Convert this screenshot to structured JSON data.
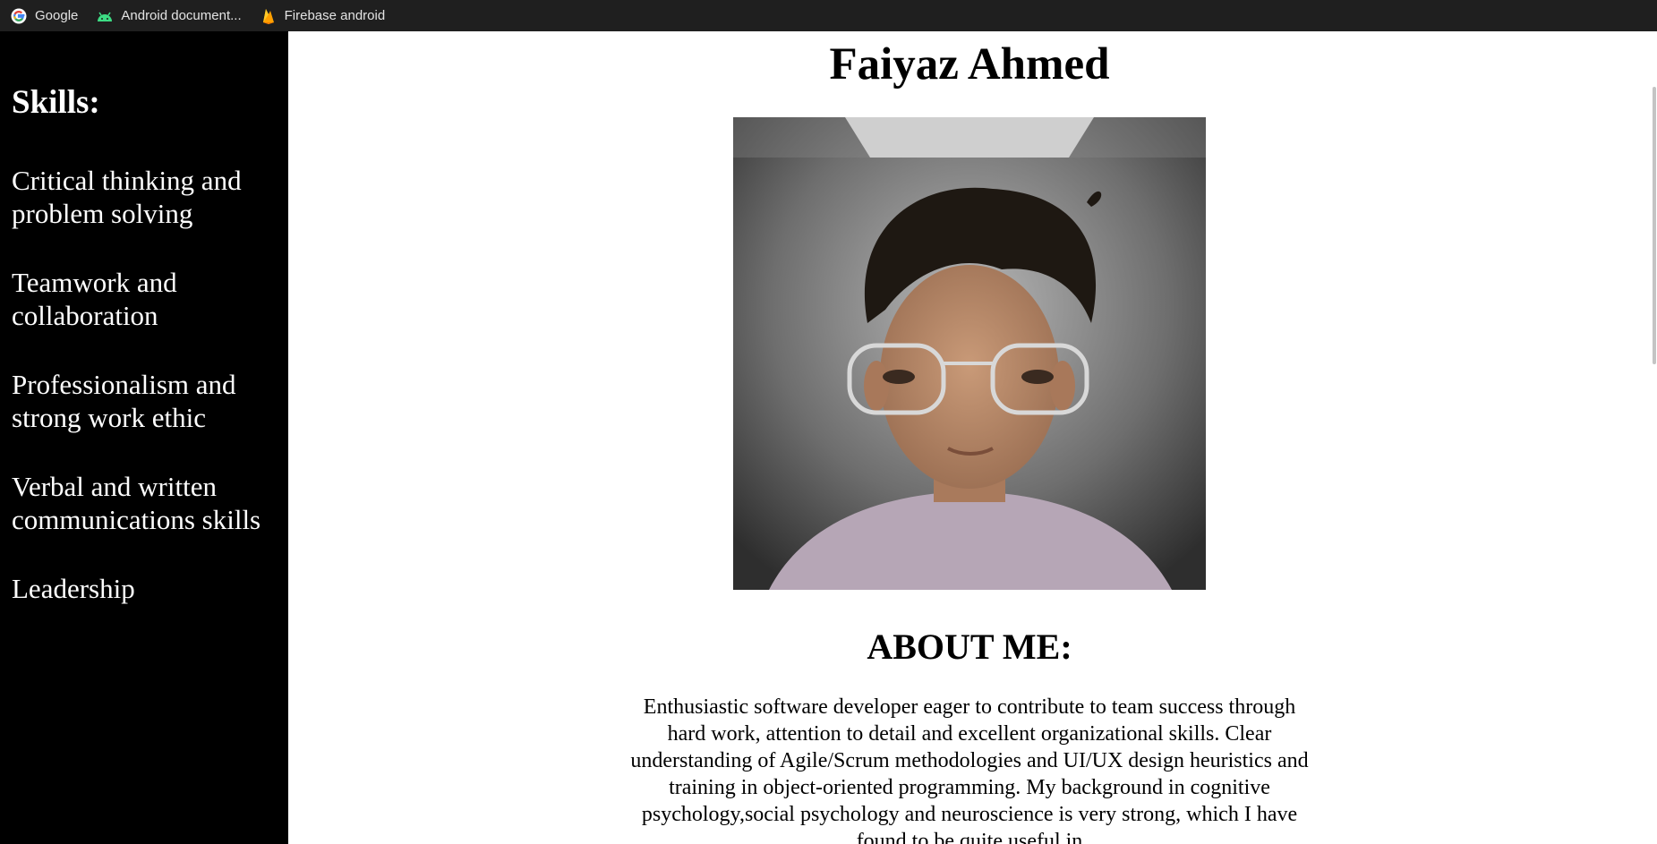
{
  "bookmarks": [
    {
      "label": "Google",
      "icon": "google-icon"
    },
    {
      "label": "Android document...",
      "icon": "android-icon"
    },
    {
      "label": "Firebase android",
      "icon": "firebase-icon"
    }
  ],
  "sidebar": {
    "heading": "Skills:",
    "skills": [
      "Critical thinking and problem solving",
      "Teamwork and collaboration",
      "Professionalism and strong work ethic",
      "Verbal and written communications skills",
      "Leadership"
    ]
  },
  "main": {
    "title": "Faiyaz Ahmed",
    "about_heading": "ABOUT ME:",
    "about_text": "Enthusiastic software developer eager to contribute to team success through hard work, attention to detail and excellent organizational skills. Clear understanding of Agile/Scrum methodologies and UI/UX design heuristics and training in object-oriented programming. My background in cognitive psychology,social psychology and neuroscience is very strong, which I have found to be quite useful in"
  },
  "colors": {
    "sidebar_bg": "#000000",
    "bookmarks_bg": "#1f1f1f",
    "main_bg": "#ffffff"
  }
}
